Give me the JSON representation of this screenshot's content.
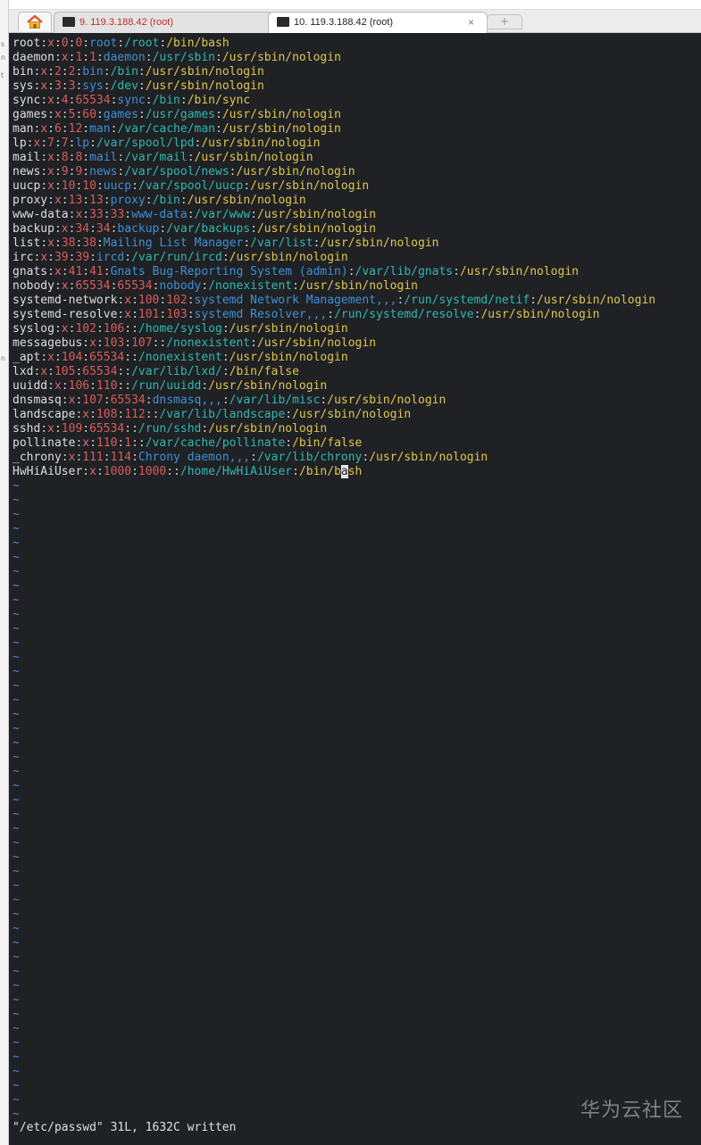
{
  "window": {
    "tabs": [
      {
        "label": "9. 119.3.188.42 (root)",
        "active": false,
        "color": "#c62828"
      },
      {
        "label": "10. 119.3.188.42 (root)",
        "active": true,
        "color": "#222222"
      }
    ],
    "close_symbol": "×",
    "home_icon": "home-icon",
    "new_tab_symbol": "+"
  },
  "colors": {
    "name": "#dedede",
    "sep": "#c9c9c9",
    "x": "#dc6a6a",
    "num": "#d85c5c",
    "gecos": "#3f8fd6",
    "home": "#31b8b0",
    "shell": "#e0c64e",
    "tilde": "#5a7bd0"
  },
  "passwd": [
    [
      "root",
      "x",
      "0",
      "0",
      "root",
      "/root",
      "/bin/bash"
    ],
    [
      "daemon",
      "x",
      "1",
      "1",
      "daemon",
      "/usr/sbin",
      "/usr/sbin/nologin"
    ],
    [
      "bin",
      "x",
      "2",
      "2",
      "bin",
      "/bin",
      "/usr/sbin/nologin"
    ],
    [
      "sys",
      "x",
      "3",
      "3",
      "sys",
      "/dev",
      "/usr/sbin/nologin"
    ],
    [
      "sync",
      "x",
      "4",
      "65534",
      "sync",
      "/bin",
      "/bin/sync"
    ],
    [
      "games",
      "x",
      "5",
      "60",
      "games",
      "/usr/games",
      "/usr/sbin/nologin"
    ],
    [
      "man",
      "x",
      "6",
      "12",
      "man",
      "/var/cache/man",
      "/usr/sbin/nologin"
    ],
    [
      "lp",
      "x",
      "7",
      "7",
      "lp",
      "/var/spool/lpd",
      "/usr/sbin/nologin"
    ],
    [
      "mail",
      "x",
      "8",
      "8",
      "mail",
      "/var/mail",
      "/usr/sbin/nologin"
    ],
    [
      "news",
      "x",
      "9",
      "9",
      "news",
      "/var/spool/news",
      "/usr/sbin/nologin"
    ],
    [
      "uucp",
      "x",
      "10",
      "10",
      "uucp",
      "/var/spool/uucp",
      "/usr/sbin/nologin"
    ],
    [
      "proxy",
      "x",
      "13",
      "13",
      "proxy",
      "/bin",
      "/usr/sbin/nologin"
    ],
    [
      "www-data",
      "x",
      "33",
      "33",
      "www-data",
      "/var/www",
      "/usr/sbin/nologin"
    ],
    [
      "backup",
      "x",
      "34",
      "34",
      "backup",
      "/var/backups",
      "/usr/sbin/nologin"
    ],
    [
      "list",
      "x",
      "38",
      "38",
      "Mailing List Manager",
      "/var/list",
      "/usr/sbin/nologin"
    ],
    [
      "irc",
      "x",
      "39",
      "39",
      "ircd",
      "/var/run/ircd",
      "/usr/sbin/nologin"
    ],
    [
      "gnats",
      "x",
      "41",
      "41",
      "Gnats Bug-Reporting System (admin)",
      "/var/lib/gnats",
      "/usr/sbin/nologin"
    ],
    [
      "nobody",
      "x",
      "65534",
      "65534",
      "nobody",
      "/nonexistent",
      "/usr/sbin/nologin"
    ],
    [
      "systemd-network",
      "x",
      "100",
      "102",
      "systemd Network Management,,,",
      "/run/systemd/netif",
      "/usr/sbin/nologin"
    ],
    [
      "systemd-resolve",
      "x",
      "101",
      "103",
      "systemd Resolver,,,",
      "/run/systemd/resolve",
      "/usr/sbin/nologin"
    ],
    [
      "syslog",
      "x",
      "102",
      "106",
      "",
      "/home/syslog",
      "/usr/sbin/nologin"
    ],
    [
      "messagebus",
      "x",
      "103",
      "107",
      "",
      "/nonexistent",
      "/usr/sbin/nologin"
    ],
    [
      "_apt",
      "x",
      "104",
      "65534",
      "",
      "/nonexistent",
      "/usr/sbin/nologin"
    ],
    [
      "lxd",
      "x",
      "105",
      "65534",
      "",
      "/var/lib/lxd/",
      "/bin/false"
    ],
    [
      "uuidd",
      "x",
      "106",
      "110",
      "",
      "/run/uuidd",
      "/usr/sbin/nologin"
    ],
    [
      "dnsmasq",
      "x",
      "107",
      "65534",
      "dnsmasq,,,",
      "/var/lib/misc",
      "/usr/sbin/nologin"
    ],
    [
      "landscape",
      "x",
      "108",
      "112",
      "",
      "/var/lib/landscape",
      "/usr/sbin/nologin"
    ],
    [
      "sshd",
      "x",
      "109",
      "65534",
      "",
      "/run/sshd",
      "/usr/sbin/nologin"
    ],
    [
      "pollinate",
      "x",
      "110",
      "1",
      "",
      "/var/cache/pollinate",
      "/bin/false"
    ],
    [
      "_chrony",
      "x",
      "111",
      "114",
      "Chrony daemon,,,",
      "/var/lib/chrony",
      "/usr/sbin/nologin"
    ],
    [
      "HwHiAiUser",
      "x",
      "1000",
      "1000",
      "",
      "/home/HwHiAiUser",
      "/bin/bash"
    ]
  ],
  "cursor": {
    "line": 30,
    "shell_char_index": 6
  },
  "empty_line_marker": "~",
  "empty_line_count": 45,
  "status_line": "\"/etc/passwd\" 31L, 1632C written",
  "watermark": "华为云社区"
}
